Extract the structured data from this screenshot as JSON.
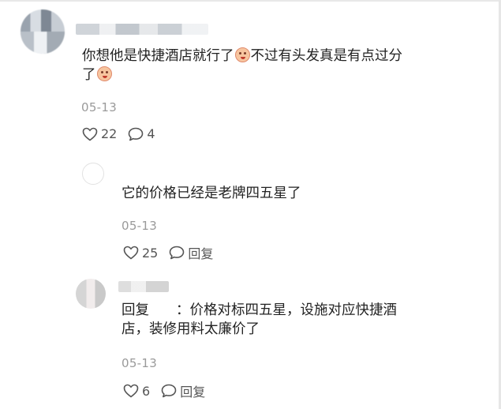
{
  "main_comment": {
    "text_line1": "你想他是快捷酒店就行了",
    "text_line1b": "不过有头发真是有点过分",
    "text_line2": "了",
    "date": "05-13",
    "likes": "22",
    "replies": "4"
  },
  "reply1": {
    "text": "它的价格已经是老牌四五星了",
    "date": "05-13",
    "likes": "25",
    "reply_label": "回复"
  },
  "reply2": {
    "prefix": "回复",
    "text_line1": "：价格对标四五星，设施对应快捷酒",
    "text_line2": "店，装修用料太廉价了",
    "date": "05-13",
    "likes": "6",
    "reply_label": "回复"
  },
  "icons": {
    "like": "heart-outline-icon",
    "comment": "speech-bubble-icon",
    "emoji": "crying-face-emoji"
  }
}
